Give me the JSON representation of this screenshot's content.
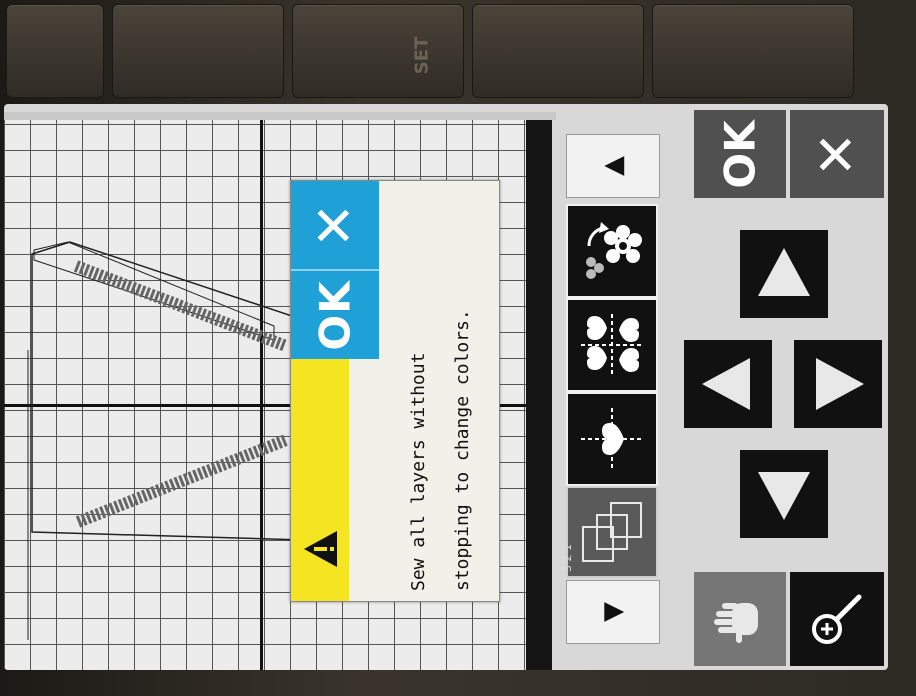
{
  "hardware_buttons": [
    {
      "name": "sew-key",
      "label": ""
    },
    {
      "name": "edit-key",
      "label": ""
    },
    {
      "name": "set-key",
      "label": "SET"
    },
    {
      "name": "help-key",
      "label": ""
    },
    {
      "name": "menu-key",
      "label": ""
    }
  ],
  "dialog": {
    "message_line1": "Sew all layers without",
    "message_line2": "stopping to change colors.",
    "ok_label": "OK",
    "close_label": "✕",
    "icon": "warning-icon"
  },
  "panel": {
    "scroll_up": "▲",
    "scroll_down": "▼",
    "ok_label": "OK",
    "cancel_label": "✕",
    "layers_label": "3 2 1"
  },
  "colors": {
    "dialog_accent": "#1fa0d6",
    "dialog_header": "#f5e422",
    "grid_bg": "#ececec"
  }
}
